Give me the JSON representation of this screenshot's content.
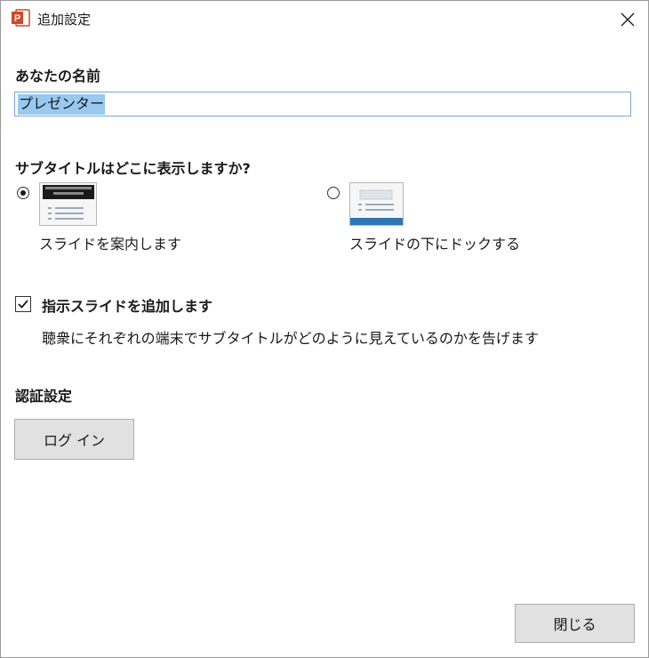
{
  "window": {
    "title": "追加設定",
    "close_icon": "close-icon",
    "app_icon": "powerpoint-icon"
  },
  "name_section": {
    "label": "あなたの名前",
    "value": "プレゼンター"
  },
  "subtitle_section": {
    "label": "サブタイトルはどこに表示しますか?",
    "options": [
      {
        "label": "スライドを案内します",
        "selected": true,
        "thumbnail": "slide-overlay-thumbnail"
      },
      {
        "label": "スライドの下にドックする",
        "selected": false,
        "thumbnail": "slide-docked-thumbnail"
      }
    ]
  },
  "pointer_slide": {
    "checked": true,
    "label": "指示スライドを追加します",
    "description": "聴衆にそれぞれの端末でサブタイトルがどのように見えているのかを告げます"
  },
  "auth_section": {
    "label": "認証設定",
    "login_label": "ログ イン"
  },
  "footer": {
    "close_label": "閉じる"
  },
  "colors": {
    "accent": "#d24726",
    "selection": "#99c9ef",
    "input_border": "#7aa7d6",
    "button_bg": "#e1e1e1",
    "dock_bar": "#2e75b6"
  }
}
